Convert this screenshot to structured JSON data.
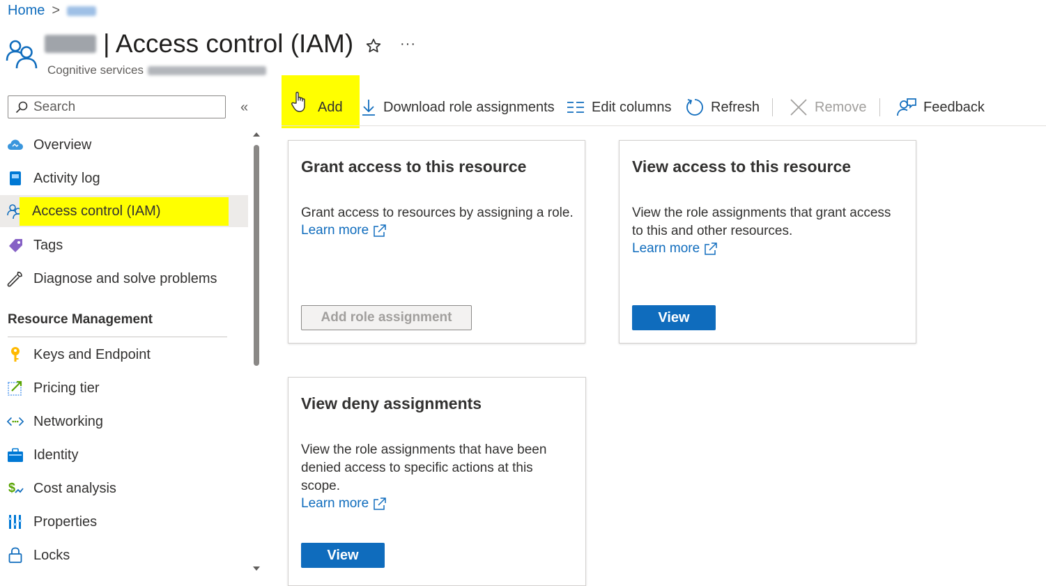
{
  "breadcrumb": {
    "home": "Home",
    "separator": ">"
  },
  "header": {
    "title": "| Access control (IAM)",
    "subtitle": "Cognitive services",
    "more_label": "···",
    "icons": {
      "resource": "people-icon",
      "favorite": "star-icon"
    }
  },
  "search": {
    "placeholder": "Search",
    "collapse_label": "«"
  },
  "sidebar": {
    "items": [
      {
        "label": "Overview",
        "icon": "cloud-icon"
      },
      {
        "label": "Activity log",
        "icon": "log-book-icon"
      },
      {
        "label": "Access control (IAM)",
        "icon": "people-icon",
        "active": true
      },
      {
        "label": "Tags",
        "icon": "tag-icon"
      },
      {
        "label": "Diagnose and solve problems",
        "icon": "wrench-icon"
      }
    ],
    "section_title": "Resource Management",
    "section_items": [
      {
        "label": "Keys and Endpoint",
        "icon": "key-icon"
      },
      {
        "label": "Pricing tier",
        "icon": "pricing-icon"
      },
      {
        "label": "Networking",
        "icon": "network-icon"
      },
      {
        "label": "Identity",
        "icon": "identity-icon"
      },
      {
        "label": "Cost analysis",
        "icon": "cost-icon"
      },
      {
        "label": "Properties",
        "icon": "properties-icon"
      },
      {
        "label": "Locks",
        "icon": "lock-icon"
      }
    ]
  },
  "toolbar": {
    "add": "Add",
    "download": "Download role assignments",
    "edit_columns": "Edit columns",
    "refresh": "Refresh",
    "remove": "Remove",
    "feedback": "Feedback"
  },
  "cards": {
    "grant": {
      "title": "Grant access to this resource",
      "description": "Grant access to resources by assigning a role.",
      "learn_more": "Learn more",
      "button": "Add role assignment"
    },
    "view": {
      "title": "View access to this resource",
      "description": "View the role assignments that grant access to this and other resources.",
      "learn_more": "Learn more",
      "button": "View"
    },
    "deny": {
      "title": "View deny assignments",
      "description": "View the role assignments that have been denied access to specific actions at this scope.",
      "learn_more": "Learn more",
      "button": "View"
    }
  },
  "colors": {
    "accent": "#0f6cbd",
    "highlight": "#ffff00",
    "active_bg": "#edebe9"
  }
}
